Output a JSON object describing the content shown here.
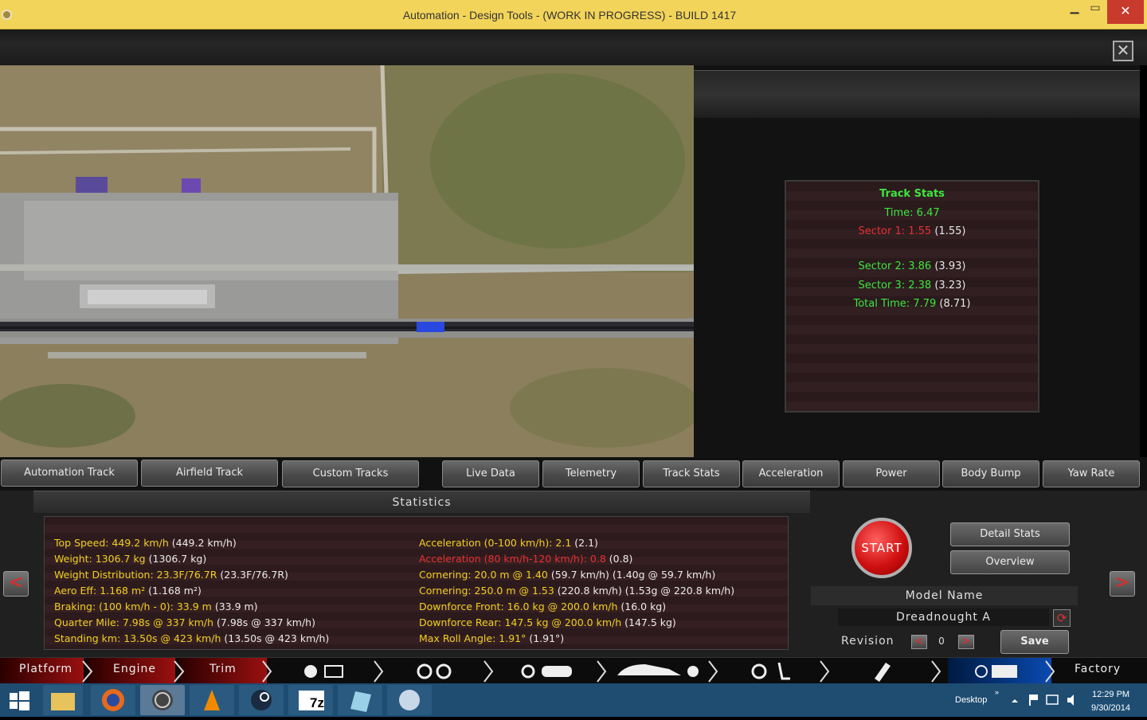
{
  "window": {
    "title": "Automation - Design Tools - (WORK IN PROGRESS) - BUILD 1417",
    "close_glyph": "✕"
  },
  "track_stats": {
    "title": "Track Stats",
    "time": "Time: 6.47",
    "sector1": "Sector 1: 1.55",
    "sector1_ref": "(1.55)",
    "sector2": "Sector 2: 3.86",
    "sector2_ref": "(3.93)",
    "sector3": "Sector 3: 2.38",
    "sector3_ref": "(3.23)",
    "total": "Total Time: 7.79",
    "total_ref": "(8.71)"
  },
  "tabs": {
    "track_tabs": [
      "Automation Track",
      "Airfield Track",
      "Custom Tracks"
    ],
    "data_tabs": [
      "Live Data",
      "Telemetry",
      "Track Stats",
      "Acceleration",
      "Power",
      "Body Bump",
      "Yaw Rate"
    ]
  },
  "statistics": {
    "header": "Statistics",
    "left": [
      {
        "label": "Top Speed: 449.2 km/h",
        "ref": "(449.2 km/h)",
        "color": "yellow"
      },
      {
        "label": "Weight: 1306.7 kg",
        "ref": "(1306.7 kg)",
        "color": "yellow"
      },
      {
        "label": "Weight Distribution: 23.3F/76.7R",
        "ref": "(23.3F/76.7R)",
        "color": "yellow"
      },
      {
        "label": "Aero Eff: 1.168 m²",
        "ref": "(1.168 m²)",
        "color": "yellow"
      },
      {
        "label": "Braking: (100 km/h - 0): 33.9 m",
        "ref": "(33.9 m)",
        "color": "yellow"
      },
      {
        "label": "Quarter Mile: 7.98s @ 337 km/h",
        "ref": "(7.98s @ 337 km/h)",
        "color": "yellow"
      },
      {
        "label": "Standing km: 13.50s @ 423 km/h",
        "ref": "(13.50s @ 423 km/h)",
        "color": "yellow"
      }
    ],
    "right": [
      {
        "label": "Acceleration (0-100 km/h): 2.1",
        "ref": "(2.1)",
        "color": "yellow"
      },
      {
        "label": "Acceleration (80 km/h-120 km/h): 0.8",
        "ref": "(0.8)",
        "color": "red"
      },
      {
        "label": "Cornering: 20.0 m @ 1.40",
        "ref": "(59.7 km/h) (1.40g @ 59.7 km/h)",
        "color": "yellow"
      },
      {
        "label": "Cornering: 250.0 m @ 1.53",
        "ref": "(220.8 km/h) (1.53g @ 220.8 km/h)",
        "color": "yellow"
      },
      {
        "label": "Downforce Front: 16.0 kg @ 200.0 km/h",
        "ref": "(16.0 kg)",
        "color": "yellow"
      },
      {
        "label": "Downforce Rear: 147.5 kg @ 200.0 km/h",
        "ref": "(147.5 kg)",
        "color": "yellow"
      },
      {
        "label": "Max Roll Angle: 1.91°",
        "ref": "(1.91°)",
        "color": "yellow"
      }
    ]
  },
  "controls": {
    "start": "START",
    "detail_stats": "Detail Stats",
    "overview": "Overview",
    "model_name_label": "Model Name",
    "model_name": "Dreadnought A",
    "revision_label": "Revision",
    "revision_value": "0",
    "save": "Save",
    "prev": "<",
    "next": ">"
  },
  "bottom_nav": {
    "items": [
      "Platform",
      "Engine",
      "Trim",
      "Factory"
    ]
  },
  "taskbar": {
    "desktop": "Desktop",
    "time": "12:29 PM",
    "date": "9/30/2014",
    "sevenzip": "7z"
  }
}
